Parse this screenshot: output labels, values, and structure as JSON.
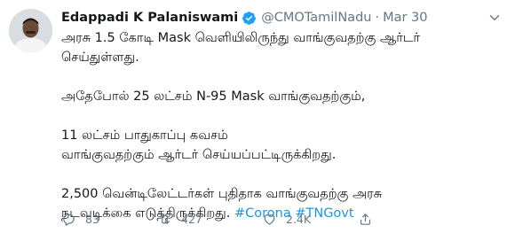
{
  "author": {
    "name": "Edappadi K Palaniswami",
    "handle": "@CMOTamilNadu",
    "separator": "·",
    "date": "Mar 30"
  },
  "tweet": {
    "line1": "அரசு 1.5 கோடி Mask வெளியிலிருந்து வாங்குவதற்கு ஆர்டர்",
    "line2": "செய்துள்ளது.",
    "line3": "அதேபோல் 25 லட்சம் N-95 Mask வாங்குவதற்கும்,",
    "line4": "11 லட்சம் பாதுகாப்பு கவசம்",
    "line5": "வாங்குவதற்கும் ஆர்டர் செய்யப்பட்டிருக்கிறது.",
    "line6": "2,500 வென்டிலேட்டர்கள் புதிதாக வாங்குவதற்கு அரசு",
    "line7": "நடவடிக்கை எடுத்திருக்கிறது.",
    "hashtag1": "#Corona",
    "hashtag2": "#TNGovt"
  },
  "actions": {
    "reply_count": "83",
    "retweet_count": "427",
    "like_count": "2.4K"
  },
  "icons": [
    "verified-icon",
    "chevron-down-icon",
    "reply-icon",
    "retweet-icon",
    "like-icon",
    "share-icon"
  ],
  "colors": {
    "text": "#14171a",
    "secondary": "#657786",
    "link": "#1b95e0",
    "verified": "#1da1f2"
  }
}
